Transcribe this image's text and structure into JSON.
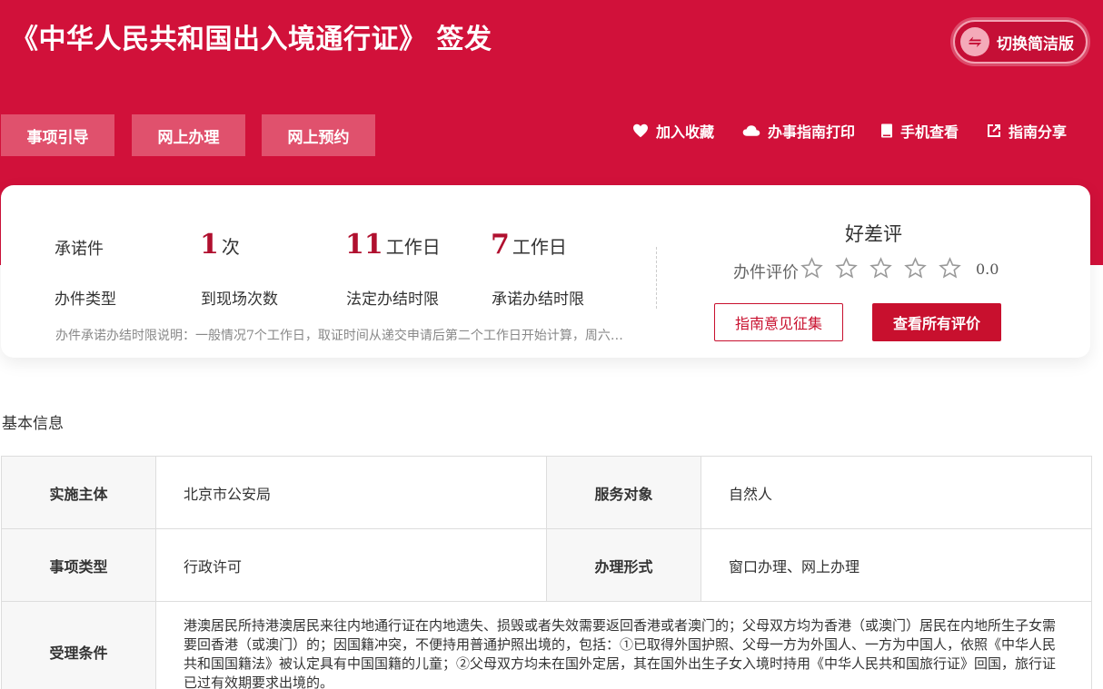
{
  "header": {
    "title": "《中华人民共和国出入境通行证》 签发",
    "switch_label": "切换简洁版",
    "tabs": [
      "事项引导",
      "网上办理",
      "网上预约"
    ],
    "actions": [
      "加入收藏",
      "办事指南打印",
      "手机查看",
      "指南分享"
    ]
  },
  "summary": {
    "type_value": "承诺件",
    "type_label": "办件类型",
    "visits_num": "1",
    "visits_unit": "次",
    "visits_label": "到现场次数",
    "legal_num": "11",
    "legal_unit": "工作日",
    "legal_label": "法定办结时限",
    "promise_num": "7",
    "promise_unit": "工作日",
    "promise_label": "承诺办结时限",
    "note": "办件承诺办结时限说明：一般情况7个工作日，取证时间从递交申请后第二个工作日开始计算，周六日、法定节假日除外。"
  },
  "rating": {
    "title": "好差评",
    "label": "办件评价",
    "stars": 5,
    "filled": 0,
    "score": "0.0",
    "feedback_button": "指南意见征集",
    "view_all_button": "查看所有评价"
  },
  "basic_info": {
    "title": "基本信息",
    "rows": [
      {
        "k1": "实施主体",
        "v1": "北京市公安局",
        "k2": "服务对象",
        "v2": "自然人"
      },
      {
        "k1": "事项类型",
        "v1": "行政许可",
        "k2": "办理形式",
        "v2": "窗口办理、网上办理"
      }
    ],
    "condition_label": "受理条件",
    "condition_text": "港澳居民所持港澳居民来往内地通行证在内地遗失、损毁或者失效需要返回香港或者澳门的；父母双方均为香港（或澳门）居民在内地所生子女需要回香港（或澳门）的；因国籍冲突，不便持用普通护照出境的，包括：①已取得外国护照、父母一方为外国人、一方为中国人，依照《中华人民共和国国籍法》被认定具有中国国籍的儿童；②父母双方均未在国外定居，其在国外出生子女入境时持用《中华人民共和国旅行证》回国，旅行证已过有效期要求出境的。"
  },
  "colors": {
    "brand_red": "#d1113a",
    "tab_bg": "#e0516d",
    "accent": "#c8102e"
  }
}
